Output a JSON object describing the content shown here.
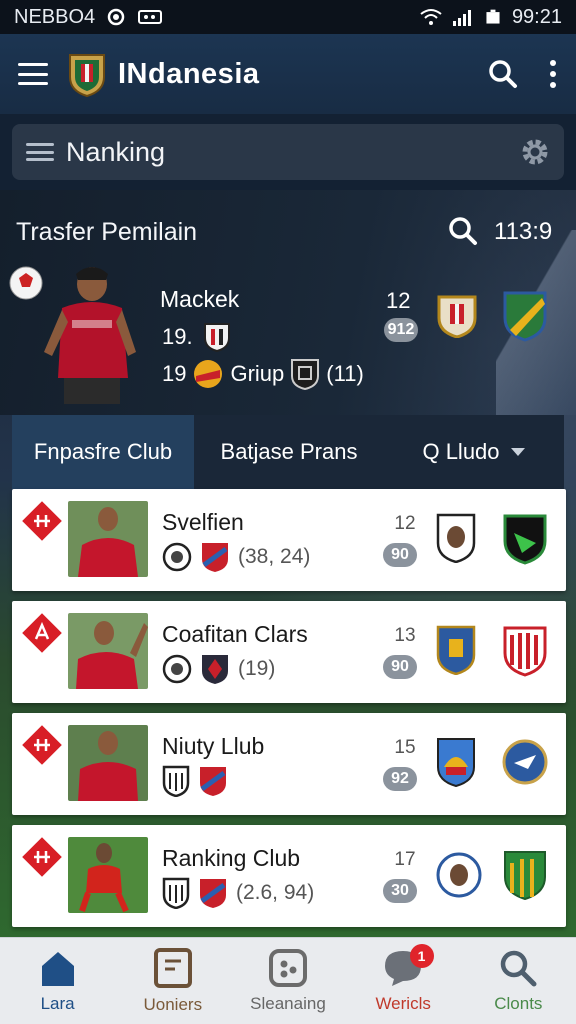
{
  "status_bar": {
    "carrier": "NEBBO4",
    "time": "99:21"
  },
  "app_bar": {
    "title": "INdanesia"
  },
  "ranking_bar": {
    "label": "Nanking"
  },
  "transfer": {
    "title": "Trasfer Pemilain",
    "count": "113:9",
    "player_name": "Mackek",
    "line2_value": "19.",
    "line3_value": "19",
    "group_label": "Griup",
    "group_count": "(11)",
    "rank": "12",
    "score": "912"
  },
  "tabs": [
    {
      "label": "Fnpasfre Club"
    },
    {
      "label": "Batjase Prans"
    },
    {
      "label": "Q Lludo"
    }
  ],
  "clubs": [
    {
      "name": "Svelfien",
      "stats": "(38, 24)",
      "rank": "12",
      "score": "90"
    },
    {
      "name": "Coafitan Clars",
      "stats": "(19)",
      "rank": "13",
      "score": "90"
    },
    {
      "name": "Niuty Llub",
      "stats": "",
      "rank": "15",
      "score": "92"
    },
    {
      "name": "Ranking Club",
      "stats": "(2.6, 94)",
      "rank": "17",
      "score": "30"
    }
  ],
  "bottom_nav": [
    {
      "label": "Lara",
      "icon": "home-icon"
    },
    {
      "label": "Uoniers",
      "icon": "document-icon"
    },
    {
      "label": "Sleanaing",
      "icon": "ball-icon"
    },
    {
      "label": "Wericls",
      "icon": "chat-icon",
      "badge": "1"
    },
    {
      "label": "Clonts",
      "icon": "search-icon"
    }
  ],
  "colors": {
    "app_bar": "#1c3552",
    "accent_red": "#e0242b",
    "active_nav": "#1f4f86",
    "active_tab": "#24405e"
  }
}
